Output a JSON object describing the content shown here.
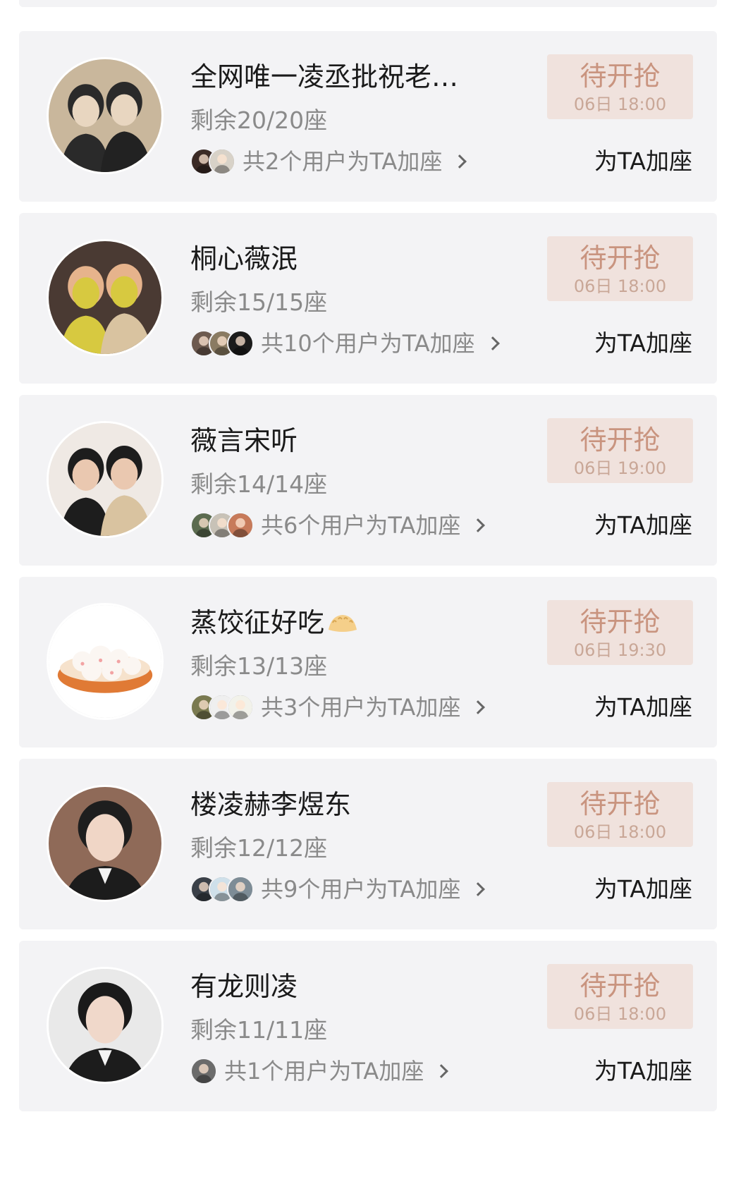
{
  "rows": [
    {
      "title": "全网唯一凌丞批祝老…",
      "remaining": "剩余20/20座",
      "users_text": "共2个用户为TA加座",
      "status": "待开抢",
      "time": "06日 18:00",
      "action": "为TA加座",
      "avatar_colors": [
        "#c9b79c",
        "#2a2a2a",
        "#e8d6c0"
      ],
      "mini_colors": [
        "#3b2a25",
        "#d8d2c8"
      ]
    },
    {
      "title": "桐心薇泯",
      "remaining": "剩余15/15座",
      "users_text": "共10个用户为TA加座",
      "status": "待开抢",
      "time": "06日 18:00",
      "action": "为TA加座",
      "avatar_colors": [
        "#4a3a33",
        "#e6b38c",
        "#d7c940"
      ],
      "mini_colors": [
        "#6d5a4f",
        "#8a7b62",
        "#1b1b1b"
      ]
    },
    {
      "title": "薇言宋听",
      "remaining": "剩余14/14座",
      "users_text": "共6个用户为TA加座",
      "status": "待开抢",
      "time": "06日 19:00",
      "action": "为TA加座",
      "avatar_colors": [
        "#efe9e4",
        "#1d1d1d",
        "#eac8b0"
      ],
      "mini_colors": [
        "#5b6b4f",
        "#c8c2b7",
        "#c77a5a"
      ]
    },
    {
      "title": "蒸饺征好吃",
      "title_emoji": "dumpling-emoji",
      "remaining": "剩余13/13座",
      "users_text": "共3个用户为TA加座",
      "status": "待开抢",
      "time": "06日 19:30",
      "action": "为TA加座",
      "avatar_colors": [
        "#ffffff",
        "#f4efe9",
        "#e07a35"
      ],
      "mini_colors": [
        "#7a7a50",
        "#efefef",
        "#f2f2ea"
      ]
    },
    {
      "title": "楼凌赫李煜东",
      "remaining": "剩余12/12座",
      "users_text": "共9个用户为TA加座",
      "status": "待开抢",
      "time": "06日 18:00",
      "action": "为TA加座",
      "avatar_colors": [
        "#8f6a58",
        "#1e1e1e",
        "#f0d6c6"
      ],
      "mini_colors": [
        "#3a4048",
        "#cfe0ea",
        "#7d8c96"
      ]
    },
    {
      "title": "有龙则凌",
      "remaining": "剩余11/11座",
      "users_text": "共1个用户为TA加座",
      "status": "待开抢",
      "time": "06日 18:00",
      "action": "为TA加座",
      "avatar_colors": [
        "#e9e9e9",
        "#1a1a1a",
        "#f0d8ca"
      ],
      "mini_colors": [
        "#6b6b6b"
      ]
    }
  ]
}
